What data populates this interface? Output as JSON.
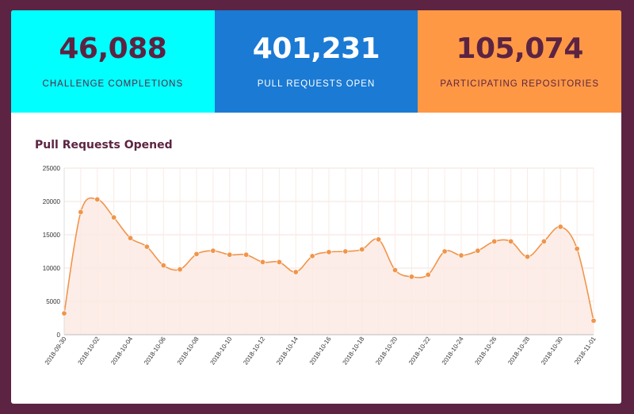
{
  "stats": [
    {
      "value": "46,088",
      "label": "CHALLENGE COMPLETIONS"
    },
    {
      "value": "401,231",
      "label": "PULL REQUESTS OPEN"
    },
    {
      "value": "105,074",
      "label": "PARTICIPATING REPOSITORIES"
    }
  ],
  "colors": {
    "background": "#5c2442",
    "cyan": "#00ffff",
    "blue": "#1a7ad4",
    "orange": "#ff9845",
    "line": "#f0954a",
    "fill": "#fde9e2"
  },
  "chart_data": {
    "type": "area",
    "title": "Pull Requests Opened",
    "xlabel": "",
    "ylabel": "",
    "ylim": [
      0,
      25000
    ],
    "yticks": [
      0,
      5000,
      10000,
      15000,
      20000,
      25000
    ],
    "grid": true,
    "x": [
      "2018-09-30",
      "2018-10-01",
      "2018-10-02",
      "2018-10-03",
      "2018-10-04",
      "2018-10-05",
      "2018-10-06",
      "2018-10-07",
      "2018-10-08",
      "2018-10-09",
      "2018-10-10",
      "2018-10-11",
      "2018-10-12",
      "2018-10-13",
      "2018-10-14",
      "2018-10-15",
      "2018-10-16",
      "2018-10-17",
      "2018-10-18",
      "2018-10-19",
      "2018-10-20",
      "2018-10-21",
      "2018-10-22",
      "2018-10-23",
      "2018-10-24",
      "2018-10-25",
      "2018-10-26",
      "2018-10-27",
      "2018-10-28",
      "2018-10-29",
      "2018-10-30",
      "2018-10-31",
      "2018-11-01"
    ],
    "xtick_labels": [
      "2018-09-30",
      "2018-10-02",
      "2018-10-04",
      "2018-10-06",
      "2018-10-08",
      "2018-10-10",
      "2018-10-12",
      "2018-10-14",
      "2018-10-16",
      "2018-10-18",
      "2018-10-20",
      "2018-10-22",
      "2018-10-24",
      "2018-10-26",
      "2018-10-28",
      "2018-10-30",
      "2018-11-01"
    ],
    "series": [
      {
        "values": [
          3200,
          18400,
          20300,
          17600,
          14500,
          13200,
          10400,
          9800,
          12100,
          12600,
          12000,
          12000,
          10900,
          10900,
          9400,
          11800,
          12400,
          12500,
          12800,
          14300,
          9700,
          8700,
          9000,
          12500,
          11900,
          12600,
          14000,
          14000,
          11700,
          14000,
          16200,
          12900,
          2100
        ]
      }
    ]
  }
}
